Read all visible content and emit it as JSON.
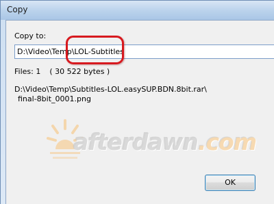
{
  "window": {
    "title": "Copy"
  },
  "form": {
    "copy_to_label": "Copy to:",
    "path_value": "D:\\Video\\Temp\\LOL-Subtitles"
  },
  "info": {
    "files_label": "Files: 1",
    "size_text": "( 30 522 bytes )",
    "source_path_line1": "D:\\Video\\Temp\\Subtitles-LOL.easySUP.BDN.8bit.rar\\",
    "source_path_line2": "final-8bit_0001.png"
  },
  "buttons": {
    "ok_label": "OK"
  },
  "watermark": {
    "text_main": "afterdawn",
    "text_suffix": ".com"
  },
  "colors": {
    "highlight": "#d7191f",
    "input_border": "#7a9cc9",
    "button_border": "#3c7fb1"
  }
}
